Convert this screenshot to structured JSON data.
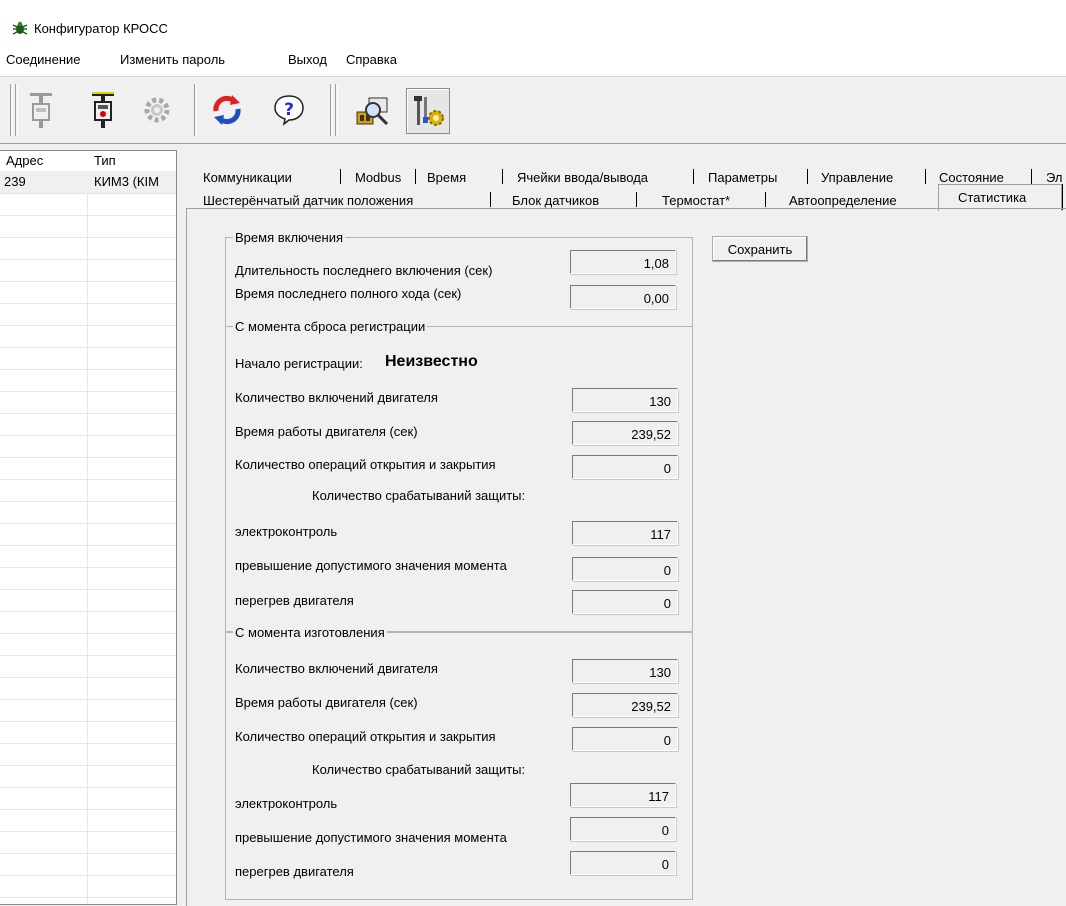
{
  "window": {
    "title": "Конфигуратор КРОСС"
  },
  "menu": [
    "Соединение",
    "Изменить пароль",
    "Выход",
    "Справка"
  ],
  "toolbar": {
    "icons": [
      "connect-device-icon",
      "disconnect-device-icon",
      "settings-gear-icon",
      "refresh-icon",
      "help-icon",
      "search-devices-icon",
      "tools-icon"
    ]
  },
  "list": {
    "headers": [
      "Адрес",
      "Тип"
    ],
    "rows": [
      {
        "address": "239",
        "type": "КИМ3 (КІМ"
      }
    ]
  },
  "tabs": {
    "row1": [
      "Коммуникации",
      "Modbus",
      "Время",
      "Ячейки ввода/вывода",
      "Параметры",
      "Управление",
      "Состояние",
      "Эл"
    ],
    "row2": [
      "Шестерёнчатый датчик положения",
      "Блок датчиков",
      "Термостат*",
      "Автоопределение",
      "Статистика"
    ],
    "active": "Статистика"
  },
  "save_button": "Сохранить",
  "power_on": {
    "title": "Время включения",
    "last_on_duration_label": "Длительность последнего включения (сек)",
    "last_on_duration_value": "1,08",
    "last_full_stroke_label": "Время последнего полного хода (сек)",
    "last_full_stroke_value": "0,00"
  },
  "since_reset": {
    "title": "С момента сброса регистрации",
    "reg_start_label": "Начало регистрации:",
    "reg_start_value": "Неизвестно",
    "motor_starts_label": "Количество включений двигателя",
    "motor_starts_value": "130",
    "motor_runtime_label": "Время работы двигателя (сек)",
    "motor_runtime_value": "239,52",
    "open_close_label": "Количество операций открытия и закрытия",
    "open_close_value": "0",
    "protection_title": "Количество срабатываний защиты:",
    "electrocontrol_label": "электроконтроль",
    "electrocontrol_value": "117",
    "torque_label": "превышение допустимого значения момента",
    "torque_value": "0",
    "overheat_label": "перегрев двигателя",
    "overheat_value": "0"
  },
  "since_manufacture": {
    "title": "С момента изготовления",
    "motor_starts_label": "Количество включений двигателя",
    "motor_starts_value": "130",
    "motor_runtime_label": "Время работы двигателя (сек)",
    "motor_runtime_value": "239,52",
    "open_close_label": "Количество операций открытия и закрытия",
    "open_close_value": "0",
    "protection_title": "Количество срабатываний защиты:",
    "electrocontrol_label": "электроконтроль",
    "electrocontrol_value": "117",
    "torque_label": "превышение допустимого значения момента",
    "torque_value": "0",
    "overheat_label": "перегрев двигателя",
    "overheat_value": "0"
  }
}
